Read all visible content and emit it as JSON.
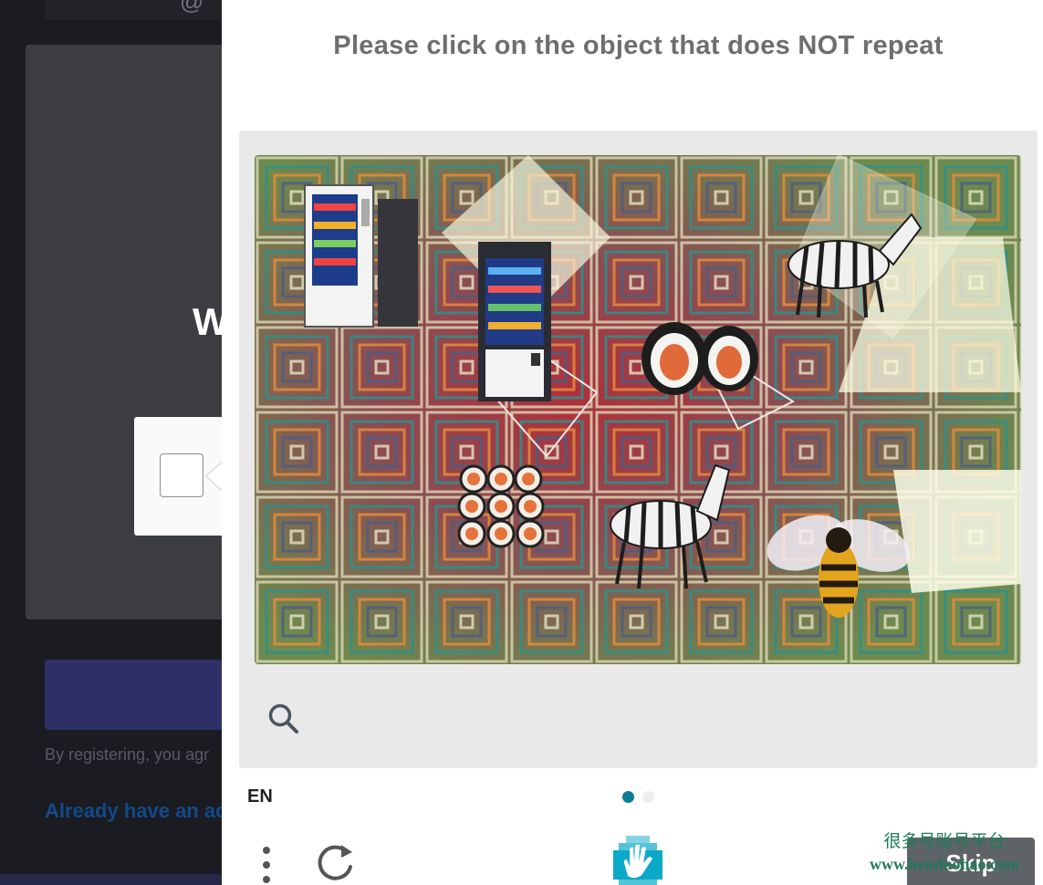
{
  "background_page": {
    "welcome_fragment": "W",
    "terms_fragment": "By registering, you agr",
    "login_link_fragment": "Already have an ac"
  },
  "challenge": {
    "prompt": "Please click on the object that does NOT repeat",
    "image_objects": [
      "vending-machine",
      "vending-machine",
      "zebra",
      "zebra",
      "sushi",
      "sushi",
      "bee"
    ],
    "zoom_icon": "search-icon",
    "language": "EN",
    "pagination": {
      "total": 2,
      "current": 1
    },
    "menu_icon": "more-vertical-icon",
    "refresh_icon": "refresh-icon",
    "logo_icon": "hcaptcha-hand-logo",
    "skip_label": "Skip",
    "accent_color": "#0b7f93"
  },
  "watermark": {
    "text_cn": "很多号账号平台",
    "text_url": "www.henduohao.com"
  }
}
